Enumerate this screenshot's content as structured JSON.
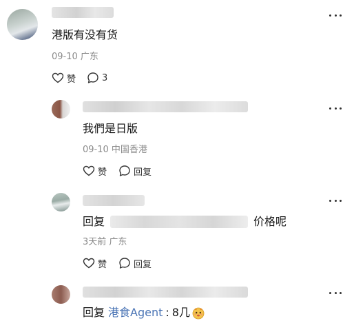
{
  "comments": [
    {
      "text": "港版有没有货",
      "date": "09-10",
      "location": "广东",
      "like_label": "赞",
      "reply_count": "3"
    }
  ],
  "replies": [
    {
      "text": "我們是日版",
      "date": "09-10",
      "location": "中国香港",
      "like_label": "赞",
      "reply_label": "回复"
    },
    {
      "text_prefix": "回复",
      "text_suffix": "价格呢",
      "date": "3天前",
      "location": "广东",
      "like_label": "赞",
      "reply_label": "回复"
    },
    {
      "text_prefix": "回复",
      "reply_to": "港食Agent",
      "separator": ":",
      "text": "8几"
    }
  ],
  "icons": {
    "more": "more-dots-icon",
    "like": "heart-outline-icon",
    "reply": "chat-bubble-icon",
    "emoji": "cute-face-emoji"
  },
  "colors": {
    "meta": "#8a8a8a",
    "reply_name": "#4a74b5"
  }
}
